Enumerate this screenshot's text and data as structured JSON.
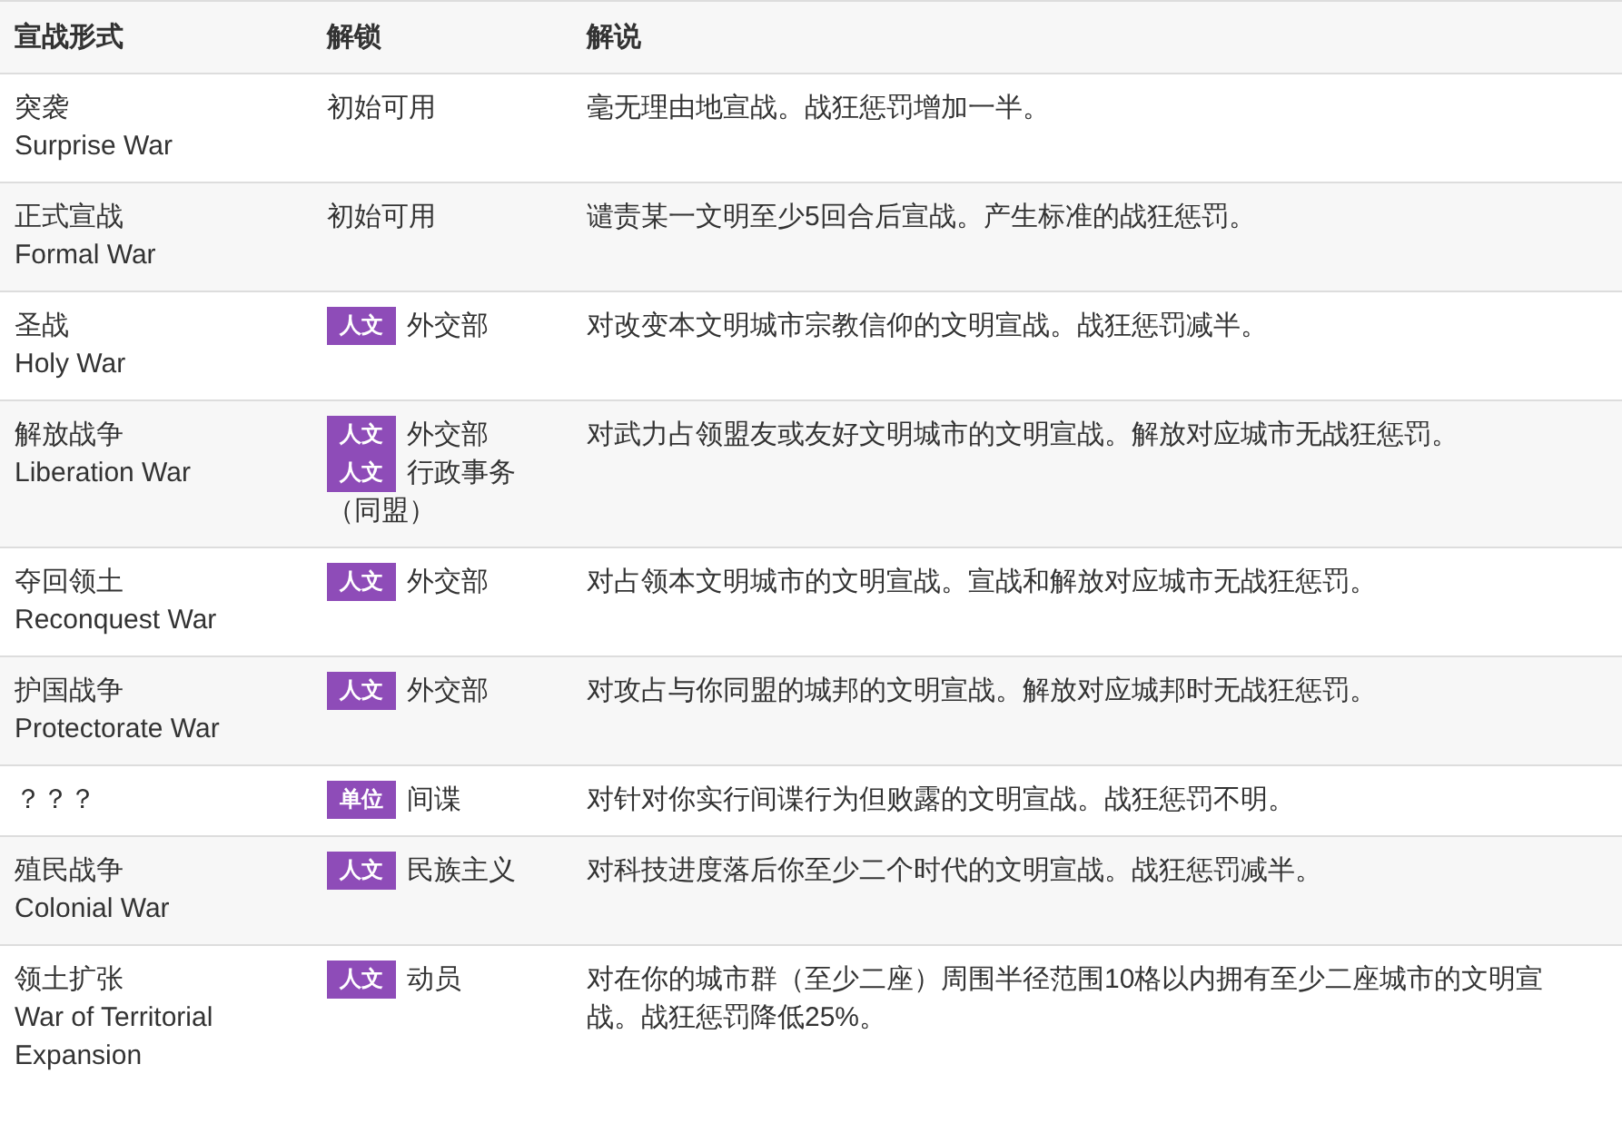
{
  "table": {
    "columns": [
      "宣战形式",
      "解锁",
      "解说"
    ],
    "rows": [
      {
        "name_zh": "突袭",
        "name_en": "Surprise War",
        "unlock": [
          {
            "text": "初始可用"
          }
        ],
        "description": "毫无理由地宣战。战狂惩罚增加一半。"
      },
      {
        "name_zh": "正式宣战",
        "name_en": "Formal War",
        "unlock": [
          {
            "text": "初始可用"
          }
        ],
        "description": "谴责某一文明至少5回合后宣战。产生标准的战狂惩罚。"
      },
      {
        "name_zh": "圣战",
        "name_en": "Holy War",
        "unlock": [
          {
            "tag": "人文",
            "text": "外交部"
          }
        ],
        "description": "对改变本文明城市宗教信仰的文明宣战。战狂惩罚减半。"
      },
      {
        "name_zh": "解放战争",
        "name_en": "Liberation War",
        "unlock": [
          {
            "tag": "人文",
            "text": "外交部"
          },
          {
            "tag": "人文",
            "text": "行政事务"
          },
          {
            "text": "（同盟）"
          }
        ],
        "description": "对武力占领盟友或友好文明城市的文明宣战。解放对应城市无战狂惩罚。"
      },
      {
        "name_zh": "夺回领土",
        "name_en": "Reconquest War",
        "unlock": [
          {
            "tag": "人文",
            "text": "外交部"
          }
        ],
        "description": "对占领本文明城市的文明宣战。宣战和解放对应城市无战狂惩罚。"
      },
      {
        "name_zh": "护国战争",
        "name_en": "Protectorate War",
        "unlock": [
          {
            "tag": "人文",
            "text": "外交部"
          }
        ],
        "description": "对攻占与你同盟的城邦的文明宣战。解放对应城邦时无战狂惩罚。"
      },
      {
        "name_zh": "？？？",
        "unlock": [
          {
            "tag": "单位",
            "text": "间谍"
          }
        ],
        "description": "对针对你实行间谍行为但败露的文明宣战。战狂惩罚不明。"
      },
      {
        "name_zh": "殖民战争",
        "name_en": "Colonial War",
        "unlock": [
          {
            "tag": "人文",
            "text": "民族主义"
          }
        ],
        "description": "对科技进度落后你至少二个时代的文明宣战。战狂惩罚减半。"
      },
      {
        "name_zh": "领土扩张",
        "name_en": "War of Territorial Expansion",
        "unlock": [
          {
            "tag": "人文",
            "text": "动员"
          }
        ],
        "description": "对在你的城市群（至少二座）周围半径范围10格以内拥有至少二座城市的文明宣战。战狂惩罚降低25%。"
      }
    ]
  }
}
